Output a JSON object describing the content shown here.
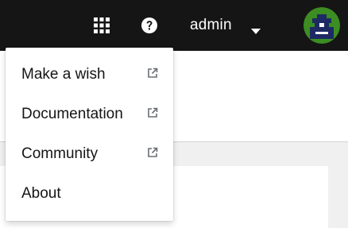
{
  "masthead": {
    "apps_icon": "grid-icon",
    "help_icon": "question-circle-icon",
    "username": "admin",
    "caret_icon": "caret-down-icon",
    "avatar_icon": "avatar-icon",
    "background_color": "#151515"
  },
  "user_menu": {
    "items": [
      {
        "label": "Make a wish",
        "external": true,
        "icon": "external-link-icon"
      },
      {
        "label": "Documentation",
        "external": true,
        "icon": "external-link-icon"
      },
      {
        "label": "Community",
        "external": true,
        "icon": "external-link-icon"
      },
      {
        "label": "About",
        "external": false
      }
    ]
  },
  "colors": {
    "text": "#151515",
    "icon_muted": "#6a6e73",
    "avatar_green": "#3c8d22",
    "avatar_navy": "#1e2a63"
  }
}
